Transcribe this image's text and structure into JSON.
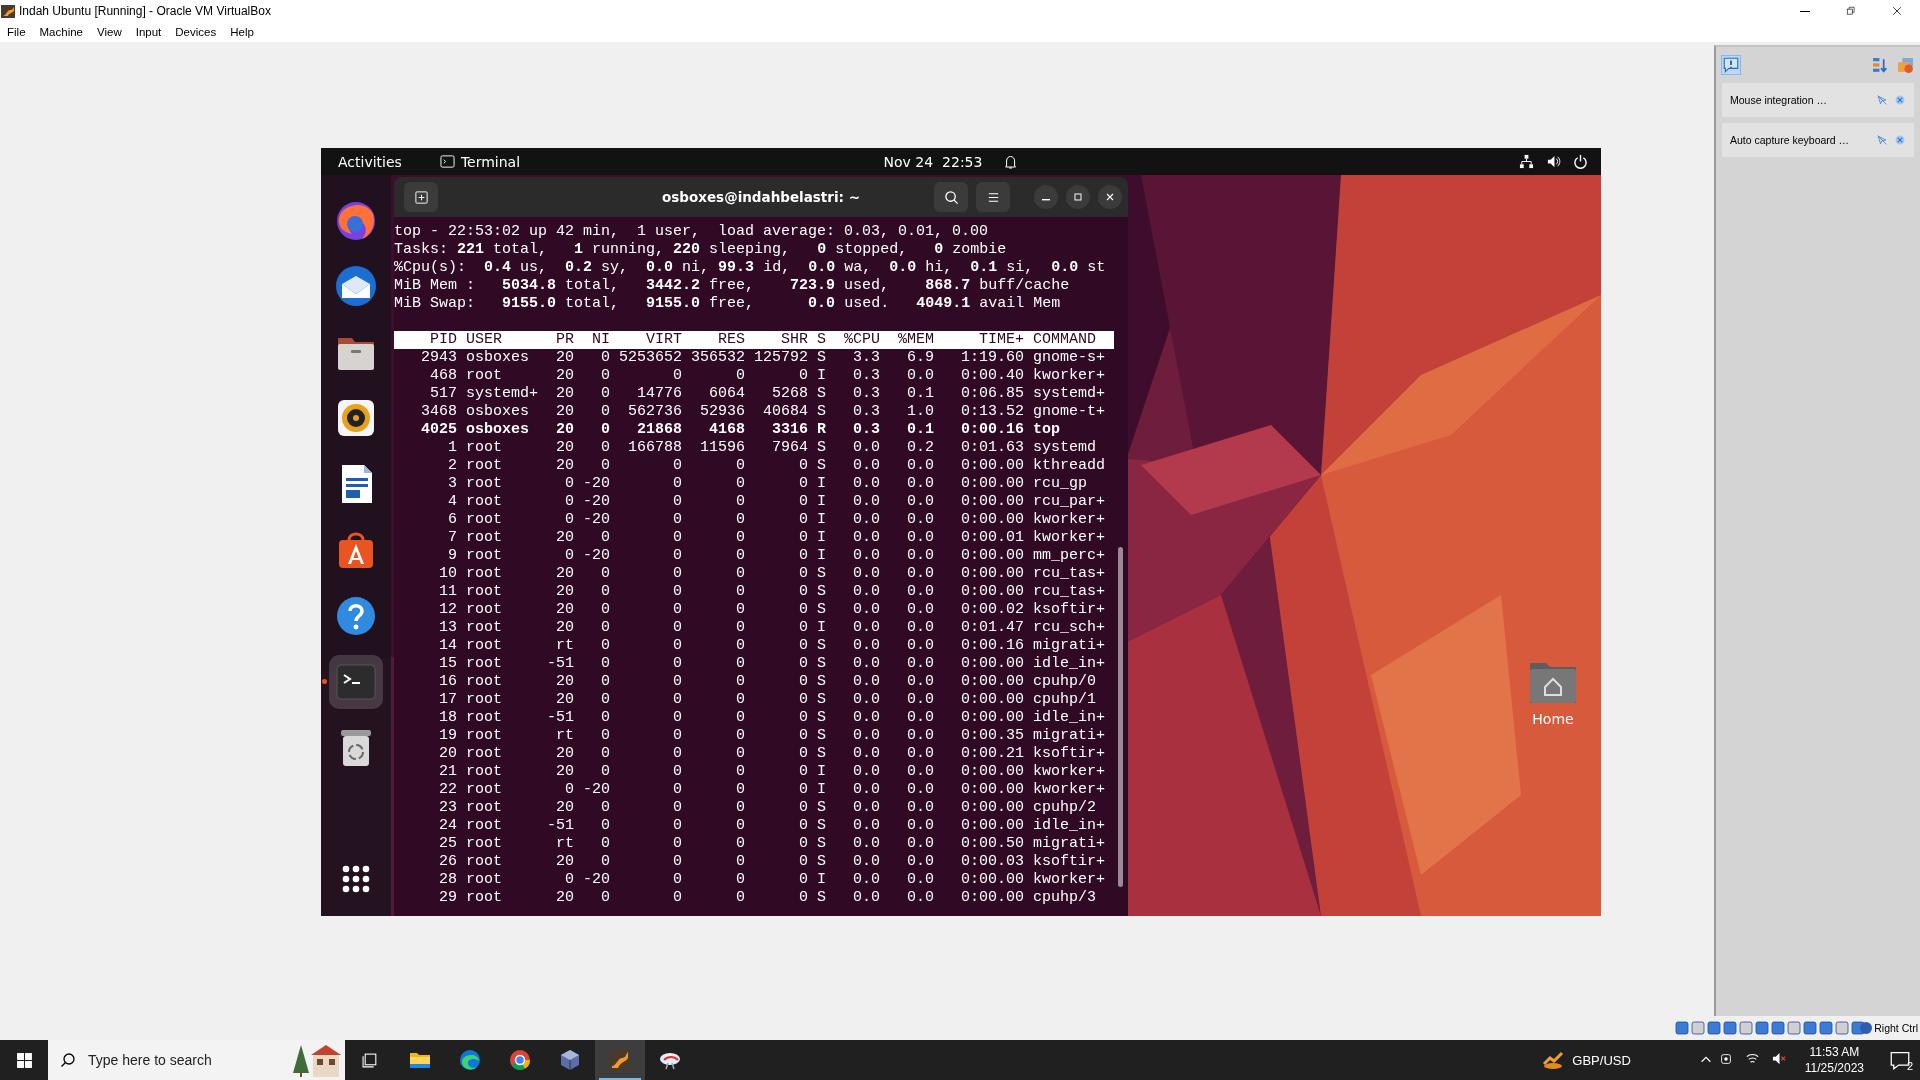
{
  "window": {
    "title": "Indah Ubuntu [Running] - Oracle VM VirtualBox"
  },
  "menu": [
    "File",
    "Machine",
    "View",
    "Input",
    "Devices",
    "Help"
  ],
  "vm": {
    "top_bar": {
      "activities": "Activities",
      "app": "Terminal",
      "clock": "Nov 24  22:53"
    },
    "dock": [
      {
        "kind": "firefox",
        "active": false
      },
      {
        "kind": "mail",
        "active": false
      },
      {
        "kind": "files",
        "active": false
      },
      {
        "kind": "music",
        "active": false
      },
      {
        "kind": "document",
        "active": false
      },
      {
        "kind": "store",
        "active": false
      },
      {
        "kind": "help",
        "active": false
      },
      {
        "kind": "terminal",
        "active": true
      },
      {
        "kind": "trash",
        "active": false
      },
      {
        "kind": "grid",
        "active": false
      }
    ],
    "terminal": {
      "title": "osboxes@indahbelastri: ~",
      "summary": [
        "top - 22:53:02 up 42 min,  1 user,  load average: 0.03, 0.01, 0.00",
        "Tasks: **221** total,   **1** running, **220** sleeping,   **0** stopped,   **0** zombie",
        "%Cpu(s):  **0.4** us,  **0.2** sy,  **0.0** ni, **99.3** id,  **0.0** wa,  **0.0** hi,  **0.1** si,  **0.0** st",
        "MiB Mem :   **5034.8** total,   **3442.2** free,    **723.9** used,    **868.7** buff/cache",
        "MiB Swap:   **9155.0** total,   **9155.0** free,      **0.0** used.   **4049.1** avail Mem"
      ],
      "columns": [
        "PID",
        "USER",
        "PR",
        "NI",
        "VIRT",
        "RES",
        "SHR",
        "S",
        "%CPU",
        "%MEM",
        "TIME+",
        "COMMAND"
      ],
      "rows": [
        {
          "cells": [
            "2943",
            "osboxes",
            "20",
            "0",
            "5253652",
            "356532",
            "125792",
            "S",
            "3.3",
            "6.9",
            "1:19.60",
            "gnome-s+"
          ],
          "highlighted": false
        },
        {
          "cells": [
            "468",
            "root",
            "20",
            "0",
            "0",
            "0",
            "0",
            "I",
            "0.3",
            "0.0",
            "0:00.40",
            "kworker+"
          ],
          "highlighted": false
        },
        {
          "cells": [
            "517",
            "systemd+",
            "20",
            "0",
            "14776",
            "6064",
            "5268",
            "S",
            "0.3",
            "0.1",
            "0:06.85",
            "systemd+"
          ],
          "highlighted": false
        },
        {
          "cells": [
            "3468",
            "osboxes",
            "20",
            "0",
            "562736",
            "52936",
            "40684",
            "S",
            "0.3",
            "1.0",
            "0:13.52",
            "gnome-t+"
          ],
          "highlighted": false
        },
        {
          "cells": [
            "4025",
            "osboxes",
            "20",
            "0",
            "21868",
            "4168",
            "3316",
            "R",
            "0.3",
            "0.1",
            "0:00.16",
            "top"
          ],
          "highlighted": true
        },
        {
          "cells": [
            "1",
            "root",
            "20",
            "0",
            "166788",
            "11596",
            "7964",
            "S",
            "0.0",
            "0.2",
            "0:01.63",
            "systemd"
          ],
          "highlighted": false
        },
        {
          "cells": [
            "2",
            "root",
            "20",
            "0",
            "0",
            "0",
            "0",
            "S",
            "0.0",
            "0.0",
            "0:00.00",
            "kthreadd"
          ],
          "highlighted": false
        },
        {
          "cells": [
            "3",
            "root",
            "0",
            "-20",
            "0",
            "0",
            "0",
            "I",
            "0.0",
            "0.0",
            "0:00.00",
            "rcu_gp"
          ],
          "highlighted": false
        },
        {
          "cells": [
            "4",
            "root",
            "0",
            "-20",
            "0",
            "0",
            "0",
            "I",
            "0.0",
            "0.0",
            "0:00.00",
            "rcu_par+"
          ],
          "highlighted": false
        },
        {
          "cells": [
            "6",
            "root",
            "0",
            "-20",
            "0",
            "0",
            "0",
            "I",
            "0.0",
            "0.0",
            "0:00.00",
            "kworker+"
          ],
          "highlighted": false
        },
        {
          "cells": [
            "7",
            "root",
            "20",
            "0",
            "0",
            "0",
            "0",
            "I",
            "0.0",
            "0.0",
            "0:00.01",
            "kworker+"
          ],
          "highlighted": false
        },
        {
          "cells": [
            "9",
            "root",
            "0",
            "-20",
            "0",
            "0",
            "0",
            "I",
            "0.0",
            "0.0",
            "0:00.00",
            "mm_perc+"
          ],
          "highlighted": false
        },
        {
          "cells": [
            "10",
            "root",
            "20",
            "0",
            "0",
            "0",
            "0",
            "S",
            "0.0",
            "0.0",
            "0:00.00",
            "rcu_tas+"
          ],
          "highlighted": false
        },
        {
          "cells": [
            "11",
            "root",
            "20",
            "0",
            "0",
            "0",
            "0",
            "S",
            "0.0",
            "0.0",
            "0:00.00",
            "rcu_tas+"
          ],
          "highlighted": false
        },
        {
          "cells": [
            "12",
            "root",
            "20",
            "0",
            "0",
            "0",
            "0",
            "S",
            "0.0",
            "0.0",
            "0:00.02",
            "ksoftir+"
          ],
          "highlighted": false
        },
        {
          "cells": [
            "13",
            "root",
            "20",
            "0",
            "0",
            "0",
            "0",
            "I",
            "0.0",
            "0.0",
            "0:01.47",
            "rcu_sch+"
          ],
          "highlighted": false
        },
        {
          "cells": [
            "14",
            "root",
            "rt",
            "0",
            "0",
            "0",
            "0",
            "S",
            "0.0",
            "0.0",
            "0:00.16",
            "migrati+"
          ],
          "highlighted": false
        },
        {
          "cells": [
            "15",
            "root",
            "-51",
            "0",
            "0",
            "0",
            "0",
            "S",
            "0.0",
            "0.0",
            "0:00.00",
            "idle_in+"
          ],
          "highlighted": false
        },
        {
          "cells": [
            "16",
            "root",
            "20",
            "0",
            "0",
            "0",
            "0",
            "S",
            "0.0",
            "0.0",
            "0:00.00",
            "cpuhp/0"
          ],
          "highlighted": false
        },
        {
          "cells": [
            "17",
            "root",
            "20",
            "0",
            "0",
            "0",
            "0",
            "S",
            "0.0",
            "0.0",
            "0:00.00",
            "cpuhp/1"
          ],
          "highlighted": false
        },
        {
          "cells": [
            "18",
            "root",
            "-51",
            "0",
            "0",
            "0",
            "0",
            "S",
            "0.0",
            "0.0",
            "0:00.00",
            "idle_in+"
          ],
          "highlighted": false
        },
        {
          "cells": [
            "19",
            "root",
            "rt",
            "0",
            "0",
            "0",
            "0",
            "S",
            "0.0",
            "0.0",
            "0:00.35",
            "migrati+"
          ],
          "highlighted": false
        },
        {
          "cells": [
            "20",
            "root",
            "20",
            "0",
            "0",
            "0",
            "0",
            "S",
            "0.0",
            "0.0",
            "0:00.21",
            "ksoftir+"
          ],
          "highlighted": false
        },
        {
          "cells": [
            "21",
            "root",
            "20",
            "0",
            "0",
            "0",
            "0",
            "I",
            "0.0",
            "0.0",
            "0:00.00",
            "kworker+"
          ],
          "highlighted": false
        },
        {
          "cells": [
            "22",
            "root",
            "0",
            "-20",
            "0",
            "0",
            "0",
            "I",
            "0.0",
            "0.0",
            "0:00.00",
            "kworker+"
          ],
          "highlighted": false
        },
        {
          "cells": [
            "23",
            "root",
            "20",
            "0",
            "0",
            "0",
            "0",
            "S",
            "0.0",
            "0.0",
            "0:00.00",
            "cpuhp/2"
          ],
          "highlighted": false
        },
        {
          "cells": [
            "24",
            "root",
            "-51",
            "0",
            "0",
            "0",
            "0",
            "S",
            "0.0",
            "0.0",
            "0:00.00",
            "idle_in+"
          ],
          "highlighted": false
        },
        {
          "cells": [
            "25",
            "root",
            "rt",
            "0",
            "0",
            "0",
            "0",
            "S",
            "0.0",
            "0.0",
            "0:00.50",
            "migrati+"
          ],
          "highlighted": false
        },
        {
          "cells": [
            "26",
            "root",
            "20",
            "0",
            "0",
            "0",
            "0",
            "S",
            "0.0",
            "0.0",
            "0:00.03",
            "ksoftir+"
          ],
          "highlighted": false
        },
        {
          "cells": [
            "28",
            "root",
            "0",
            "-20",
            "0",
            "0",
            "0",
            "I",
            "0.0",
            "0.0",
            "0:00.00",
            "kworker+"
          ],
          "highlighted": false
        },
        {
          "cells": [
            "29",
            "root",
            "20",
            "0",
            "0",
            "0",
            "0",
            "S",
            "0.0",
            "0.0",
            "0:00.00",
            "cpuhp/3"
          ],
          "highlighted": false
        }
      ]
    },
    "desktop_icons": [
      {
        "label": "Home"
      }
    ]
  },
  "vbox_panel": {
    "notifications": [
      "Mouse integration …",
      "Auto capture keyboard …"
    ]
  },
  "status_bar": {
    "host_key": "Right Ctrl"
  },
  "taskbar": {
    "search": {
      "placeholder": "Type here to search"
    },
    "apps": [
      {
        "kind": "folder",
        "active": false
      },
      {
        "kind": "edge",
        "active": false
      },
      {
        "kind": "chrome",
        "active": false
      },
      {
        "kind": "cube",
        "active": false
      },
      {
        "kind": "vm",
        "active": true
      },
      {
        "kind": "bird",
        "active": false
      }
    ],
    "ticker": "GBP/USD",
    "time": "11:53 AM",
    "date": "11/25/2023",
    "notification_count": "2"
  }
}
